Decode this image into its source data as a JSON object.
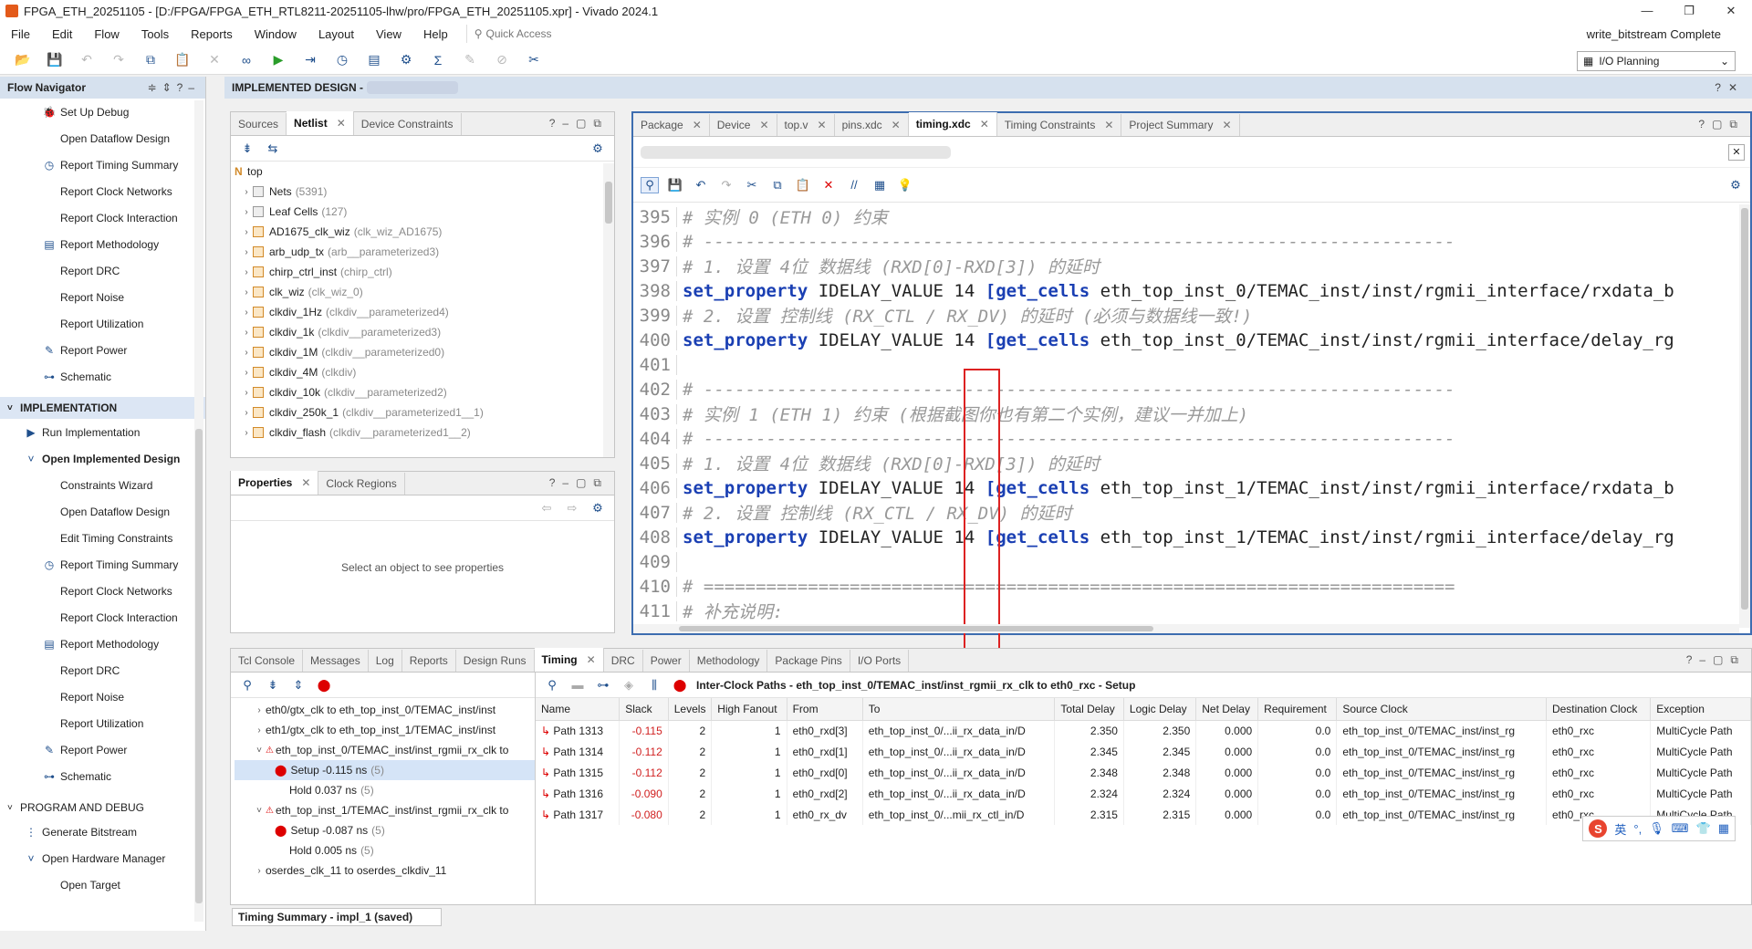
{
  "window": {
    "title": "FPGA_ETH_20251105 - [D:/FPGA/FPGA_ETH_RTL8211-20251105-lhw/pro/FPGA_ETH_20251105.xpr] - Vivado 2024.1",
    "min": "—",
    "max": "❐",
    "close": "✕"
  },
  "menu": [
    "File",
    "Edit",
    "Flow",
    "Tools",
    "Reports",
    "Window",
    "Layout",
    "View",
    "Help"
  ],
  "quick_access": "Quick Access",
  "status": "write_bitstream Complete",
  "layout_select": "I/O Planning",
  "flow_nav": {
    "title": "Flow Navigator",
    "items": [
      {
        "label": "Set Up Debug",
        "icon": "🐞",
        "indent": 46
      },
      {
        "label": "Open Dataflow Design",
        "icon": "",
        "indent": 46
      },
      {
        "label": "Report Timing Summary",
        "icon": "◷",
        "indent": 46
      },
      {
        "label": "Report Clock Networks",
        "icon": "",
        "indent": 46
      },
      {
        "label": "Report Clock Interaction",
        "icon": "",
        "indent": 46
      },
      {
        "label": "Report Methodology",
        "icon": "▤",
        "indent": 46
      },
      {
        "label": "Report DRC",
        "icon": "",
        "indent": 46
      },
      {
        "label": "Report Noise",
        "icon": "",
        "indent": 46
      },
      {
        "label": "Report Utilization",
        "icon": "",
        "indent": 46
      },
      {
        "label": "Report Power",
        "icon": "✎",
        "indent": 46
      },
      {
        "label": "Schematic",
        "icon": "⊶",
        "indent": 46
      }
    ],
    "impl_section": "IMPLEMENTATION",
    "impl_items": [
      {
        "label": "Run Implementation",
        "icon": "▶",
        "indent": 26
      },
      {
        "label": "Open Implemented Design",
        "icon": "˅",
        "indent": 26,
        "bold": true
      },
      {
        "label": "Constraints Wizard",
        "icon": "",
        "indent": 46
      },
      {
        "label": "Open Dataflow Design",
        "icon": "",
        "indent": 46
      },
      {
        "label": "Edit Timing Constraints",
        "icon": "",
        "indent": 46
      },
      {
        "label": "Report Timing Summary",
        "icon": "◷",
        "indent": 46
      },
      {
        "label": "Report Clock Networks",
        "icon": "",
        "indent": 46
      },
      {
        "label": "Report Clock Interaction",
        "icon": "",
        "indent": 46
      },
      {
        "label": "Report Methodology",
        "icon": "▤",
        "indent": 46
      },
      {
        "label": "Report DRC",
        "icon": "",
        "indent": 46
      },
      {
        "label": "Report Noise",
        "icon": "",
        "indent": 46
      },
      {
        "label": "Report Utilization",
        "icon": "",
        "indent": 46
      },
      {
        "label": "Report Power",
        "icon": "✎",
        "indent": 46
      },
      {
        "label": "Schematic",
        "icon": "⊶",
        "indent": 46
      }
    ],
    "prog_section": "PROGRAM AND DEBUG",
    "prog_items": [
      {
        "label": "Generate Bitstream",
        "icon": "⋮",
        "indent": 26
      },
      {
        "label": "Open Hardware Manager",
        "icon": "˅",
        "indent": 26
      },
      {
        "label": "Open Target",
        "icon": "",
        "indent": 46
      }
    ]
  },
  "impl_banner": "IMPLEMENTED DESIGN -",
  "netlist": {
    "tabs": [
      "Sources",
      "Netlist",
      "Device Constraints"
    ],
    "root": "top",
    "rows": [
      {
        "name": "Nets",
        "extra": "(5391)",
        "type": "folder"
      },
      {
        "name": "Leaf Cells",
        "extra": "(127)",
        "type": "folder"
      },
      {
        "name": "AD1675_clk_wiz",
        "extra": "(clk_wiz_AD1675)",
        "type": "cell"
      },
      {
        "name": "arb_udp_tx",
        "extra": "(arb__parameterized3)",
        "type": "cell"
      },
      {
        "name": "chirp_ctrl_inst",
        "extra": "(chirp_ctrl)",
        "type": "cell"
      },
      {
        "name": "clk_wiz",
        "extra": "(clk_wiz_0)",
        "type": "cell"
      },
      {
        "name": "clkdiv_1Hz",
        "extra": "(clkdiv__parameterized4)",
        "type": "cell"
      },
      {
        "name": "clkdiv_1k",
        "extra": "(clkdiv__parameterized3)",
        "type": "cell"
      },
      {
        "name": "clkdiv_1M",
        "extra": "(clkdiv__parameterized0)",
        "type": "cell"
      },
      {
        "name": "clkdiv_4M",
        "extra": "(clkdiv)",
        "type": "cell"
      },
      {
        "name": "clkdiv_10k",
        "extra": "(clkdiv__parameterized2)",
        "type": "cell"
      },
      {
        "name": "clkdiv_250k_1",
        "extra": "(clkdiv__parameterized1__1)",
        "type": "cell"
      },
      {
        "name": "clkdiv_flash",
        "extra": "(clkdiv__parameterized1__2)",
        "type": "cell"
      }
    ]
  },
  "properties": {
    "tabs": [
      "Properties",
      "Clock Regions"
    ],
    "empty": "Select an object to see properties"
  },
  "editor": {
    "tabs": [
      "Package",
      "Device",
      "top.v",
      "pins.xdc",
      "timing.xdc",
      "Timing Constraints",
      "Project Summary"
    ],
    "lines": [
      {
        "n": "395",
        "parts": [
          [
            "cm",
            "# 实例 0 (ETH 0) 约束"
          ]
        ]
      },
      {
        "n": "396",
        "parts": [
          [
            "cm",
            "# ------------------------------------------------------------------------"
          ]
        ]
      },
      {
        "n": "397",
        "parts": [
          [
            "cm",
            "# 1. 设置 4位 数据线 (RXD[0]-RXD[3]) 的延时"
          ]
        ]
      },
      {
        "n": "398",
        "parts": [
          [
            "kw",
            "set_property"
          ],
          [
            "txt",
            " IDELAY_VALUE 14 "
          ],
          [
            "kw",
            "[get_cells"
          ],
          [
            "txt",
            " eth_top_inst_0/TEMAC_inst/inst/rgmii_interface/rxdata_b"
          ]
        ]
      },
      {
        "n": "399",
        "parts": [
          [
            "cm",
            "# 2. 设置 控制线 (RX_CTL / RX_DV) 的延时 (必须与数据线一致!)"
          ]
        ]
      },
      {
        "n": "400",
        "parts": [
          [
            "kw",
            "set_property"
          ],
          [
            "txt",
            " IDELAY_VALUE 14 "
          ],
          [
            "kw",
            "[get_cells"
          ],
          [
            "txt",
            " eth_top_inst_0/TEMAC_inst/inst/rgmii_interface/delay_rg"
          ]
        ]
      },
      {
        "n": "401",
        "parts": [
          [
            "txt",
            ""
          ]
        ]
      },
      {
        "n": "402",
        "parts": [
          [
            "cm",
            "# ------------------------------------------------------------------------"
          ]
        ]
      },
      {
        "n": "403",
        "parts": [
          [
            "cm",
            "# 实例 1 (ETH 1) 约束 (根据截图你也有第二个实例，建议一并加上)"
          ]
        ]
      },
      {
        "n": "404",
        "parts": [
          [
            "cm",
            "# ------------------------------------------------------------------------"
          ]
        ]
      },
      {
        "n": "405",
        "parts": [
          [
            "cm",
            "# 1. 设置 4位 数据线 (RXD[0]-RXD[3]) 的延时"
          ]
        ]
      },
      {
        "n": "406",
        "parts": [
          [
            "kw",
            "set_property"
          ],
          [
            "txt",
            " IDELAY_VALUE 14 "
          ],
          [
            "kw",
            "[get_cells"
          ],
          [
            "txt",
            " eth_top_inst_1/TEMAC_inst/inst/rgmii_interface/rxdata_b"
          ]
        ]
      },
      {
        "n": "407",
        "parts": [
          [
            "cm",
            "# 2. 设置 控制线 (RX_CTL / RX_DV) 的延时"
          ]
        ]
      },
      {
        "n": "408",
        "parts": [
          [
            "kw",
            "set_property"
          ],
          [
            "txt",
            " IDELAY_VALUE 14 "
          ],
          [
            "kw",
            "[get_cells"
          ],
          [
            "txt",
            " eth_top_inst_1/TEMAC_inst/inst/rgmii_interface/delay_rg"
          ]
        ]
      },
      {
        "n": "409",
        "parts": [
          [
            "txt",
            ""
          ]
        ]
      },
      {
        "n": "410",
        "parts": [
          [
            "cm",
            "# ========================================================================"
          ]
        ]
      },
      {
        "n": "411",
        "parts": [
          [
            "cm",
            "# 补充说明:"
          ]
        ]
      }
    ]
  },
  "bottom": {
    "tabs": [
      "Tcl Console",
      "Messages",
      "Log",
      "Reports",
      "Design Runs",
      "Timing",
      "DRC",
      "Power",
      "Methodology",
      "Package Pins",
      "I/O Ports"
    ],
    "header": "Inter-Clock Paths - eth_top_inst_0/TEMAC_inst/inst_rgmii_rx_clk to eth0_rxc - Setup",
    "tree": [
      {
        "text": "eth0/gtx_clk to eth_top_inst_0/TEMAC_inst/inst",
        "lvl": 0,
        "car": "›"
      },
      {
        "text": "eth1/gtx_clk to eth_top_inst_1/TEMAC_inst/inst",
        "lvl": 0,
        "car": "›"
      },
      {
        "text": "eth_top_inst_0/TEMAC_inst/inst_rgmii_rx_clk to",
        "lvl": 0,
        "car": "˅",
        "warn": true
      },
      {
        "text": "Setup -0.115 ns",
        "extra": "(5)",
        "lvl": 1,
        "err": true,
        "sel": true
      },
      {
        "text": "Hold 0.037 ns",
        "extra": "(5)",
        "lvl": 1
      },
      {
        "text": "eth_top_inst_1/TEMAC_inst/inst_rgmii_rx_clk to",
        "lvl": 0,
        "car": "˅",
        "warn": true
      },
      {
        "text": "Setup -0.087 ns",
        "extra": "(5)",
        "lvl": 1,
        "err": true
      },
      {
        "text": "Hold 0.005 ns",
        "extra": "(5)",
        "lvl": 1
      },
      {
        "text": "oserdes_clk_11 to oserdes_clkdiv_11",
        "lvl": 0,
        "car": "›"
      }
    ],
    "columns": [
      "Name",
      "Slack",
      "Levels",
      "High Fanout",
      "From",
      "To",
      "Total Delay",
      "Logic Delay",
      "Net Delay",
      "Requirement",
      "Source Clock",
      "Destination Clock",
      "Exception"
    ],
    "rows": [
      [
        "Path 1313",
        "-0.115",
        "2",
        "1",
        "eth0_rxd[3]",
        "eth_top_inst_0/...ii_rx_data_in/D",
        "2.350",
        "2.350",
        "0.000",
        "0.0",
        "eth_top_inst_0/TEMAC_inst/inst_rg",
        "eth0_rxc",
        "MultiCycle Path"
      ],
      [
        "Path 1314",
        "-0.112",
        "2",
        "1",
        "eth0_rxd[1]",
        "eth_top_inst_0/...ii_rx_data_in/D",
        "2.345",
        "2.345",
        "0.000",
        "0.0",
        "eth_top_inst_0/TEMAC_inst/inst_rg",
        "eth0_rxc",
        "MultiCycle Path"
      ],
      [
        "Path 1315",
        "-0.112",
        "2",
        "1",
        "eth0_rxd[0]",
        "eth_top_inst_0/...ii_rx_data_in/D",
        "2.348",
        "2.348",
        "0.000",
        "0.0",
        "eth_top_inst_0/TEMAC_inst/inst_rg",
        "eth0_rxc",
        "MultiCycle Path"
      ],
      [
        "Path 1316",
        "-0.090",
        "2",
        "1",
        "eth0_rxd[2]",
        "eth_top_inst_0/...ii_rx_data_in/D",
        "2.324",
        "2.324",
        "0.000",
        "0.0",
        "eth_top_inst_0/TEMAC_inst/inst_rg",
        "eth0_rxc",
        "MultiCycle Path"
      ],
      [
        "Path 1317",
        "-0.080",
        "2",
        "1",
        "eth0_rx_dv",
        "eth_top_inst_0/...mii_rx_ctl_in/D",
        "2.315",
        "2.315",
        "0.000",
        "0.0",
        "eth_top_inst_0/TEMAC_inst/inst_rg",
        "eth0_rxc",
        "MultiCycle Path"
      ]
    ],
    "summary": "Timing Summary - impl_1 (saved)"
  },
  "ime": {
    "logo": "S",
    "lang": "英"
  }
}
